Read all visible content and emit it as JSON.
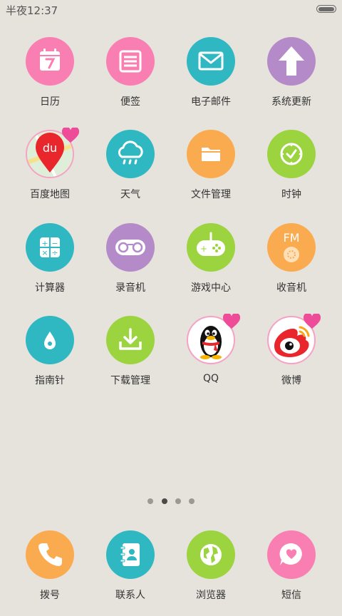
{
  "status_bar": {
    "time": "半夜12:37"
  },
  "colors": {
    "pink": "#f97fb2",
    "teal": "#2fb8c1",
    "purple": "#b48ac8",
    "orange": "#fbab4f",
    "green": "#9bd43f",
    "background": "#e6e3dd"
  },
  "apps": [
    {
      "label": "日历",
      "icon": "calendar-icon"
    },
    {
      "label": "便签",
      "icon": "notes-icon"
    },
    {
      "label": "电子邮件",
      "icon": "mail-icon"
    },
    {
      "label": "系统更新",
      "icon": "update-arrow-icon"
    },
    {
      "label": "百度地图",
      "icon": "baidu-map-icon",
      "icon_text": "du"
    },
    {
      "label": "天气",
      "icon": "weather-cloud-icon"
    },
    {
      "label": "文件管理",
      "icon": "folder-icon"
    },
    {
      "label": "时钟",
      "icon": "clock-icon"
    },
    {
      "label": "计算器",
      "icon": "calculator-icon",
      "icon_symbols": [
        "+",
        "−",
        "×",
        "÷"
      ]
    },
    {
      "label": "录音机",
      "icon": "cassette-icon"
    },
    {
      "label": "游戏中心",
      "icon": "gamepad-icon",
      "icon_symbols": [
        "+"
      ]
    },
    {
      "label": "收音机",
      "icon": "radio-icon",
      "icon_text": "FM"
    },
    {
      "label": "指南针",
      "icon": "compass-drop-icon"
    },
    {
      "label": "下载管理",
      "icon": "download-icon"
    },
    {
      "label": "QQ",
      "icon": "qq-penguin-icon"
    },
    {
      "label": "微博",
      "icon": "weibo-eye-icon"
    }
  ],
  "pager": {
    "page_count": 4,
    "current_page": 2
  },
  "dock": [
    {
      "label": "拨号",
      "icon": "phone-icon"
    },
    {
      "label": "联系人",
      "icon": "contacts-icon"
    },
    {
      "label": "浏览器",
      "icon": "browser-globe-icon"
    },
    {
      "label": "短信",
      "icon": "message-heart-icon"
    }
  ]
}
